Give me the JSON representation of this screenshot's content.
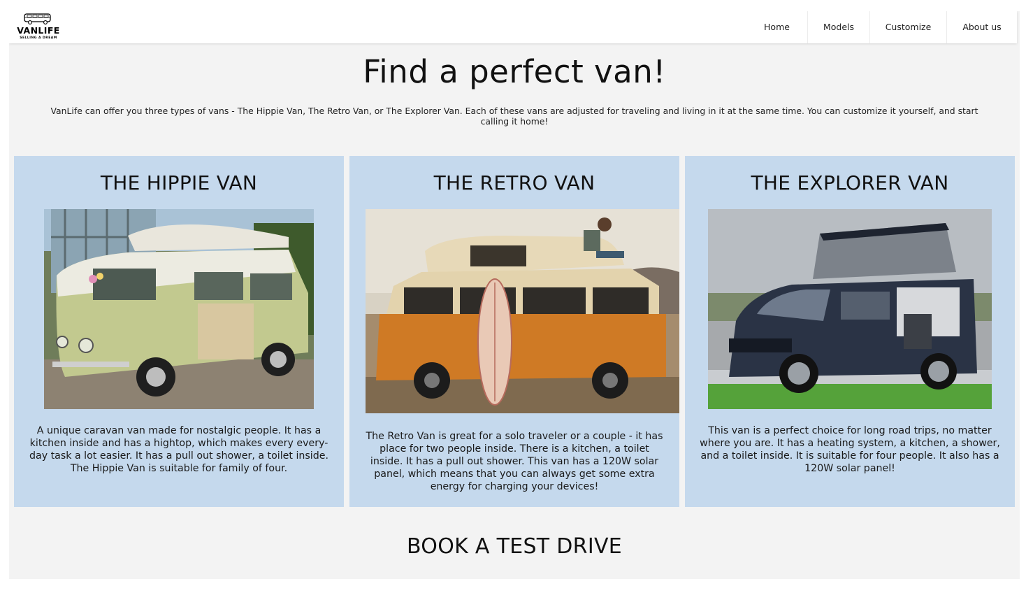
{
  "brand": {
    "name": "VANLIFE",
    "tagline": "SELLING A DREAM"
  },
  "nav": {
    "items": [
      "Home",
      "Models",
      "Customize",
      "About us"
    ]
  },
  "hero": {
    "title": "Find a perfect van!",
    "text": "VanLife can offer you three types of vans - The Hippie Van, The Retro Van, or The Explorer Van. Each of these vans are adjusted for traveling and living in it at the same time. You can customize it yourself, and start calling it home!"
  },
  "cards": [
    {
      "title": "THE HIPPIE VAN",
      "image": "hippie-van-photo",
      "text": "A unique caravan van made for nostalgic people. It has a kitchen inside and has a hightop, which makes every every-day task a lot easier. It has a pull out shower, a toilet inside. The Hippie Van is suitable for family of four."
    },
    {
      "title": "THE RETRO VAN",
      "image": "retro-van-photo",
      "text": "The Retro Van is great for a solo traveler or a couple - it has place for two people inside. There is a kitchen, a toilet inside. It has a pull out shower. This van has a 120W solar panel, which means that you can always get some extra energy for charging your devices!"
    },
    {
      "title": "THE EXPLORER VAN",
      "image": "explorer-van-photo",
      "text": "This van is a perfect choice for long road trips, no matter where you are. It has a heating system, a kitchen, a shower, and a toilet inside. It is suitable for four people. It also has a 120W solar panel!"
    }
  ],
  "book": {
    "title": "BOOK A TEST DRIVE"
  },
  "colors": {
    "page_background": "#f3f3f3",
    "card_background": "#c5d9ed",
    "navbar_background": "#ffffff"
  }
}
